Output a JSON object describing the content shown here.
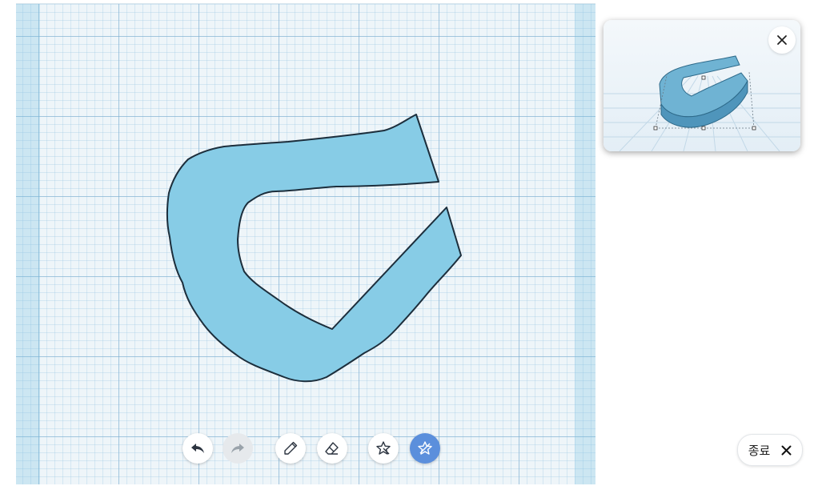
{
  "toolbar": {
    "tools": [
      {
        "name": "undo",
        "icon": "undo-icon",
        "state": "enabled"
      },
      {
        "name": "redo",
        "icon": "redo-icon",
        "state": "disabled"
      },
      {
        "name": "pencil",
        "icon": "pencil-icon",
        "state": "enabled"
      },
      {
        "name": "eraser",
        "icon": "eraser-icon",
        "state": "enabled"
      },
      {
        "name": "shape",
        "icon": "star-shape-icon",
        "state": "enabled"
      },
      {
        "name": "shape-edit",
        "icon": "star-edit-icon",
        "state": "active"
      }
    ]
  },
  "preview": {
    "close_icon": "close-icon"
  },
  "exit": {
    "label": "종료",
    "icon": "close-icon"
  },
  "colors": {
    "shape_fill": "#87cce6",
    "shape_stroke": "#1c2e3c",
    "active_tool": "#5b8fdc",
    "grid_background": "#eef5f9"
  }
}
